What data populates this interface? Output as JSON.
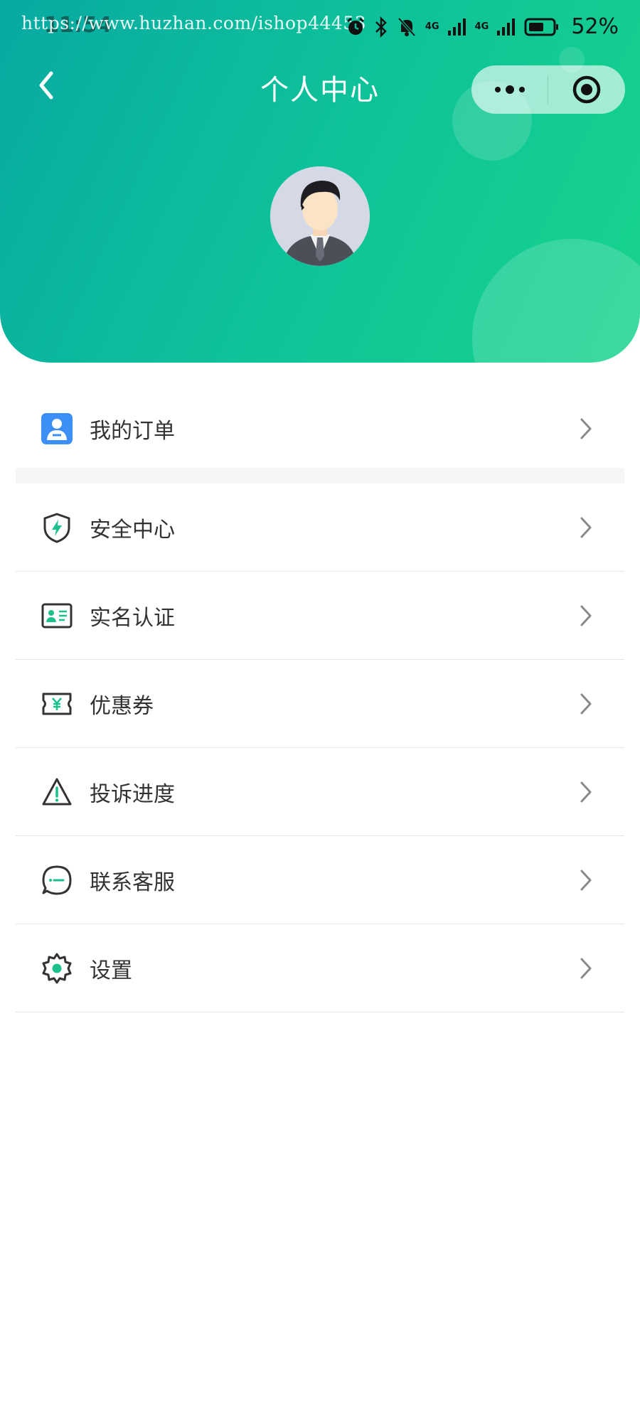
{
  "watermark": "https://www.huzhan.com/ishop44453",
  "status_bar": {
    "time": "11:54",
    "network_1": "4G",
    "network_2": "4G",
    "battery": "52%"
  },
  "header": {
    "title": "个人中心"
  },
  "menu": {
    "items": [
      {
        "label": "我的订单",
        "icon": "order-icon"
      },
      {
        "label": "安全中心",
        "icon": "shield-icon"
      },
      {
        "label": "实名认证",
        "icon": "id-card-icon"
      },
      {
        "label": "优惠券",
        "icon": "coupon-icon"
      },
      {
        "label": "投诉进度",
        "icon": "warning-icon"
      },
      {
        "label": "联系客服",
        "icon": "chat-icon"
      },
      {
        "label": "设置",
        "icon": "gear-icon"
      }
    ]
  },
  "colors": {
    "header_start": "#08a9a2",
    "header_end": "#17d48c",
    "accent": "#1dbf8f",
    "order_icon_blue": "#3b8ff7",
    "text": "#333333",
    "divider": "#e7e7e7"
  }
}
